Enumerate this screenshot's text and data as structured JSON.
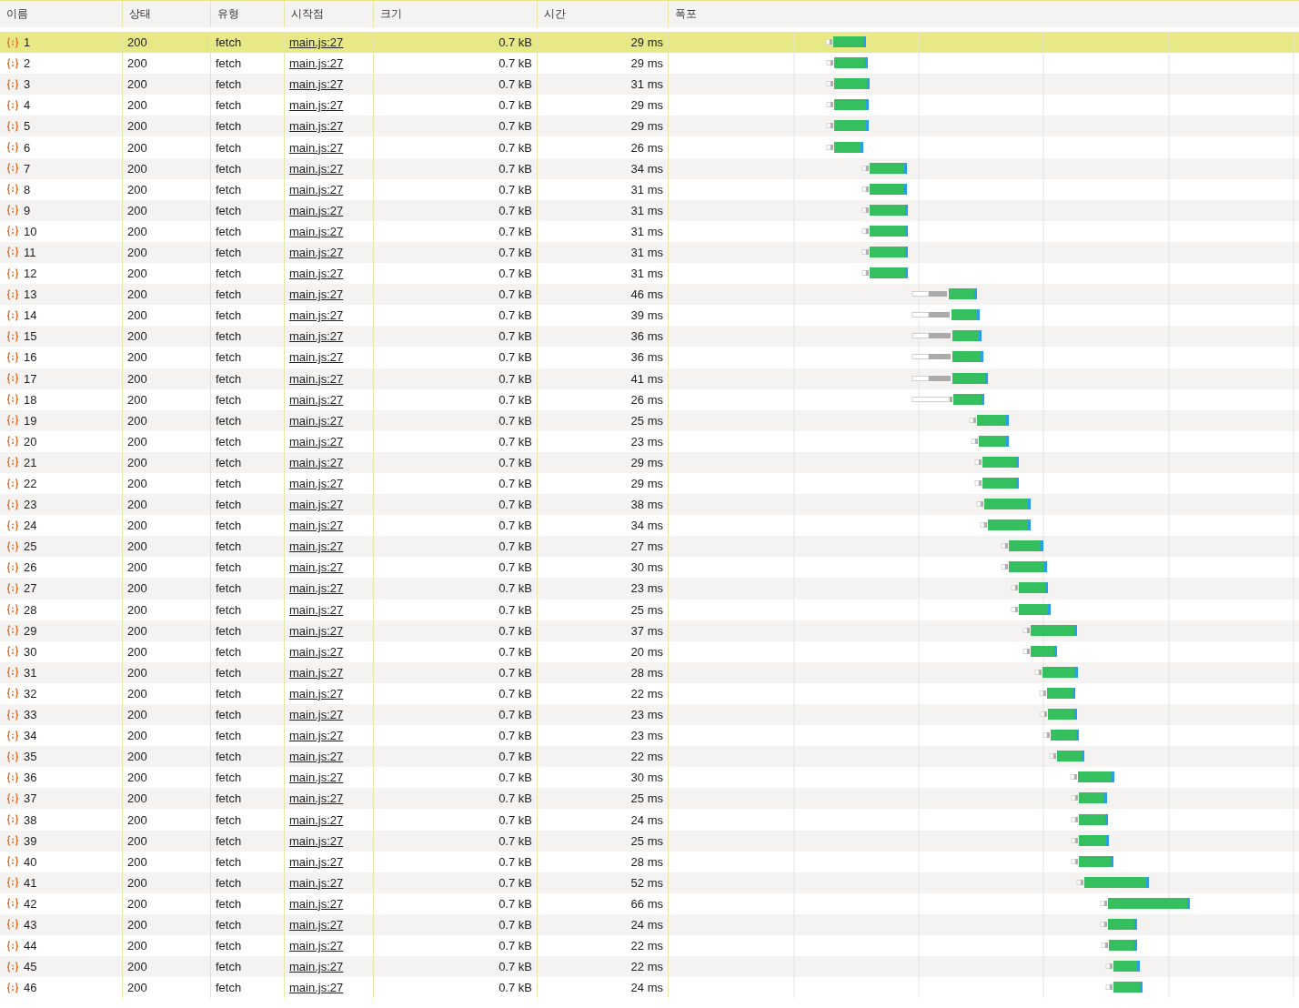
{
  "table": {
    "columns": [
      "이름",
      "상태",
      "유형",
      "시작점",
      "크기",
      "시간",
      "폭포"
    ],
    "rows": [
      {
        "name": "1",
        "status": "200",
        "type": "fetch",
        "initiator": "main.js:27",
        "size": "0.7 kB",
        "time": "29 ms",
        "selected": true
      },
      {
        "name": "2",
        "status": "200",
        "type": "fetch",
        "initiator": "main.js:27",
        "size": "0.7 kB",
        "time": "29 ms",
        "selected": false
      },
      {
        "name": "3",
        "status": "200",
        "type": "fetch",
        "initiator": "main.js:27",
        "size": "0.7 kB",
        "time": "31 ms",
        "selected": false
      },
      {
        "name": "4",
        "status": "200",
        "type": "fetch",
        "initiator": "main.js:27",
        "size": "0.7 kB",
        "time": "29 ms",
        "selected": false
      },
      {
        "name": "5",
        "status": "200",
        "type": "fetch",
        "initiator": "main.js:27",
        "size": "0.7 kB",
        "time": "29 ms",
        "selected": false
      },
      {
        "name": "6",
        "status": "200",
        "type": "fetch",
        "initiator": "main.js:27",
        "size": "0.7 kB",
        "time": "26 ms",
        "selected": false
      },
      {
        "name": "7",
        "status": "200",
        "type": "fetch",
        "initiator": "main.js:27",
        "size": "0.7 kB",
        "time": "34 ms",
        "selected": false
      },
      {
        "name": "8",
        "status": "200",
        "type": "fetch",
        "initiator": "main.js:27",
        "size": "0.7 kB",
        "time": "31 ms",
        "selected": false
      },
      {
        "name": "9",
        "status": "200",
        "type": "fetch",
        "initiator": "main.js:27",
        "size": "0.7 kB",
        "time": "31 ms",
        "selected": false
      },
      {
        "name": "10",
        "status": "200",
        "type": "fetch",
        "initiator": "main.js:27",
        "size": "0.7 kB",
        "time": "31 ms",
        "selected": false
      },
      {
        "name": "11",
        "status": "200",
        "type": "fetch",
        "initiator": "main.js:27",
        "size": "0.7 kB",
        "time": "31 ms",
        "selected": false
      },
      {
        "name": "12",
        "status": "200",
        "type": "fetch",
        "initiator": "main.js:27",
        "size": "0.7 kB",
        "time": "31 ms",
        "selected": false
      },
      {
        "name": "13",
        "status": "200",
        "type": "fetch",
        "initiator": "main.js:27",
        "size": "0.7 kB",
        "time": "46 ms",
        "selected": false
      },
      {
        "name": "14",
        "status": "200",
        "type": "fetch",
        "initiator": "main.js:27",
        "size": "0.7 kB",
        "time": "39 ms",
        "selected": false
      },
      {
        "name": "15",
        "status": "200",
        "type": "fetch",
        "initiator": "main.js:27",
        "size": "0.7 kB",
        "time": "36 ms",
        "selected": false
      },
      {
        "name": "16",
        "status": "200",
        "type": "fetch",
        "initiator": "main.js:27",
        "size": "0.7 kB",
        "time": "36 ms",
        "selected": false
      },
      {
        "name": "17",
        "status": "200",
        "type": "fetch",
        "initiator": "main.js:27",
        "size": "0.7 kB",
        "time": "41 ms",
        "selected": false
      },
      {
        "name": "18",
        "status": "200",
        "type": "fetch",
        "initiator": "main.js:27",
        "size": "0.7 kB",
        "time": "26 ms",
        "selected": false
      },
      {
        "name": "19",
        "status": "200",
        "type": "fetch",
        "initiator": "main.js:27",
        "size": "0.7 kB",
        "time": "25 ms",
        "selected": false
      },
      {
        "name": "20",
        "status": "200",
        "type": "fetch",
        "initiator": "main.js:27",
        "size": "0.7 kB",
        "time": "23 ms",
        "selected": false
      },
      {
        "name": "21",
        "status": "200",
        "type": "fetch",
        "initiator": "main.js:27",
        "size": "0.7 kB",
        "time": "29 ms",
        "selected": false
      },
      {
        "name": "22",
        "status": "200",
        "type": "fetch",
        "initiator": "main.js:27",
        "size": "0.7 kB",
        "time": "29 ms",
        "selected": false
      },
      {
        "name": "23",
        "status": "200",
        "type": "fetch",
        "initiator": "main.js:27",
        "size": "0.7 kB",
        "time": "38 ms",
        "selected": false
      },
      {
        "name": "24",
        "status": "200",
        "type": "fetch",
        "initiator": "main.js:27",
        "size": "0.7 kB",
        "time": "34 ms",
        "selected": false
      },
      {
        "name": "25",
        "status": "200",
        "type": "fetch",
        "initiator": "main.js:27",
        "size": "0.7 kB",
        "time": "27 ms",
        "selected": false
      },
      {
        "name": "26",
        "status": "200",
        "type": "fetch",
        "initiator": "main.js:27",
        "size": "0.7 kB",
        "time": "30 ms",
        "selected": false
      },
      {
        "name": "27",
        "status": "200",
        "type": "fetch",
        "initiator": "main.js:27",
        "size": "0.7 kB",
        "time": "23 ms",
        "selected": false
      },
      {
        "name": "28",
        "status": "200",
        "type": "fetch",
        "initiator": "main.js:27",
        "size": "0.7 kB",
        "time": "25 ms",
        "selected": false
      },
      {
        "name": "29",
        "status": "200",
        "type": "fetch",
        "initiator": "main.js:27",
        "size": "0.7 kB",
        "time": "37 ms",
        "selected": false
      },
      {
        "name": "30",
        "status": "200",
        "type": "fetch",
        "initiator": "main.js:27",
        "size": "0.7 kB",
        "time": "20 ms",
        "selected": false
      },
      {
        "name": "31",
        "status": "200",
        "type": "fetch",
        "initiator": "main.js:27",
        "size": "0.7 kB",
        "time": "28 ms",
        "selected": false
      },
      {
        "name": "32",
        "status": "200",
        "type": "fetch",
        "initiator": "main.js:27",
        "size": "0.7 kB",
        "time": "22 ms",
        "selected": false
      },
      {
        "name": "33",
        "status": "200",
        "type": "fetch",
        "initiator": "main.js:27",
        "size": "0.7 kB",
        "time": "23 ms",
        "selected": false
      },
      {
        "name": "34",
        "status": "200",
        "type": "fetch",
        "initiator": "main.js:27",
        "size": "0.7 kB",
        "time": "23 ms",
        "selected": false
      },
      {
        "name": "35",
        "status": "200",
        "type": "fetch",
        "initiator": "main.js:27",
        "size": "0.7 kB",
        "time": "22 ms",
        "selected": false
      },
      {
        "name": "36",
        "status": "200",
        "type": "fetch",
        "initiator": "main.js:27",
        "size": "0.7 kB",
        "time": "30 ms",
        "selected": false
      },
      {
        "name": "37",
        "status": "200",
        "type": "fetch",
        "initiator": "main.js:27",
        "size": "0.7 kB",
        "time": "25 ms",
        "selected": false
      },
      {
        "name": "38",
        "status": "200",
        "type": "fetch",
        "initiator": "main.js:27",
        "size": "0.7 kB",
        "time": "24 ms",
        "selected": false
      },
      {
        "name": "39",
        "status": "200",
        "type": "fetch",
        "initiator": "main.js:27",
        "size": "0.7 kB",
        "time": "25 ms",
        "selected": false
      },
      {
        "name": "40",
        "status": "200",
        "type": "fetch",
        "initiator": "main.js:27",
        "size": "0.7 kB",
        "time": "28 ms",
        "selected": false
      },
      {
        "name": "41",
        "status": "200",
        "type": "fetch",
        "initiator": "main.js:27",
        "size": "0.7 kB",
        "time": "52 ms",
        "selected": false
      },
      {
        "name": "42",
        "status": "200",
        "type": "fetch",
        "initiator": "main.js:27",
        "size": "0.7 kB",
        "time": "66 ms",
        "selected": false
      },
      {
        "name": "43",
        "status": "200",
        "type": "fetch",
        "initiator": "main.js:27",
        "size": "0.7 kB",
        "time": "24 ms",
        "selected": false
      },
      {
        "name": "44",
        "status": "200",
        "type": "fetch",
        "initiator": "main.js:27",
        "size": "0.7 kB",
        "time": "22 ms",
        "selected": false
      },
      {
        "name": "45",
        "status": "200",
        "type": "fetch",
        "initiator": "main.js:27",
        "size": "0.7 kB",
        "time": "22 ms",
        "selected": false
      },
      {
        "name": "46",
        "status": "200",
        "type": "fetch",
        "initiator": "main.js:27",
        "size": "0.7 kB",
        "time": "24 ms",
        "selected": false
      }
    ]
  }
}
